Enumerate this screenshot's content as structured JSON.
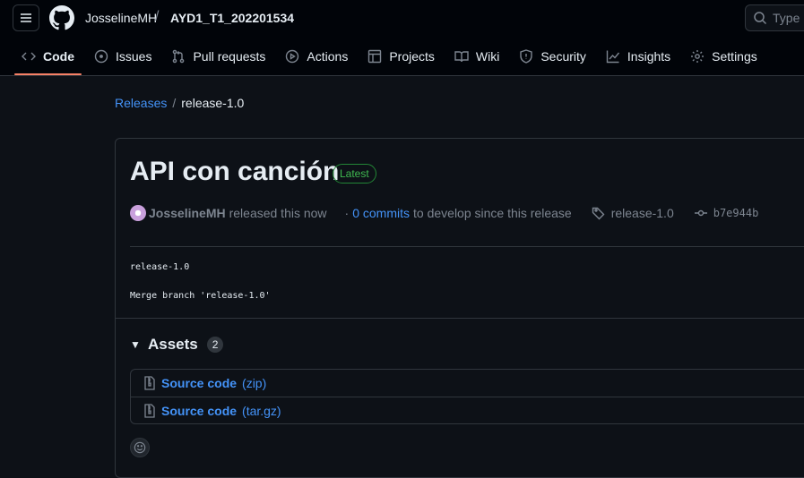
{
  "header": {
    "owner": "JosselineMH",
    "separator": "/",
    "repo": "AYD1_T1_202201534",
    "search_placeholder": "Type",
    "search_kbd": "/"
  },
  "tabs": [
    {
      "label": "Code",
      "icon": "code-icon",
      "active": true
    },
    {
      "label": "Issues",
      "icon": "issue-icon"
    },
    {
      "label": "Pull requests",
      "icon": "pull-request-icon"
    },
    {
      "label": "Actions",
      "icon": "play-icon"
    },
    {
      "label": "Projects",
      "icon": "table-icon"
    },
    {
      "label": "Wiki",
      "icon": "book-icon"
    },
    {
      "label": "Security",
      "icon": "shield-icon"
    },
    {
      "label": "Insights",
      "icon": "graph-icon"
    },
    {
      "label": "Settings",
      "icon": "gear-icon"
    }
  ],
  "breadcrumb": {
    "releases": "Releases",
    "separator": "/",
    "current": "release-1.0"
  },
  "release": {
    "title": "API con canción",
    "badge": "Latest",
    "author": "JosselineMH",
    "released_text": "released this now",
    "dot": "·",
    "commits_link": "0 commits",
    "commits_suffix": "to develop since this release",
    "tag": "release-1.0",
    "sha": "b7e944b",
    "body_line1": "release-1.0",
    "body_line2": "Merge branch 'release-1.0'"
  },
  "assets": {
    "title": "Assets",
    "count": "2",
    "items": [
      {
        "label": "Source code",
        "ext": "(zip)"
      },
      {
        "label": "Source code",
        "ext": "(tar.gz)"
      }
    ]
  },
  "colors": {
    "accent": "#f78166",
    "link": "#4493f8",
    "latest": "#3fb950",
    "background": "#0d1117"
  }
}
